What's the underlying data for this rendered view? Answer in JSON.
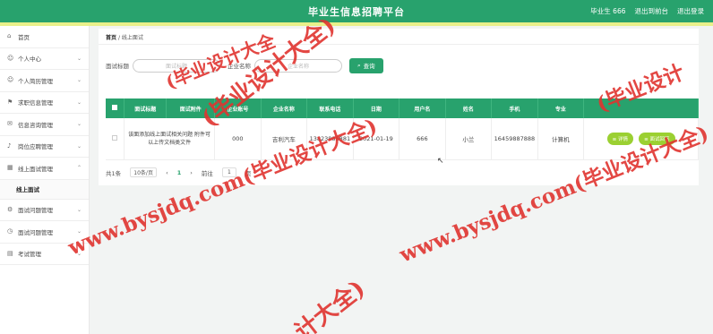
{
  "header": {
    "title": "毕业生信息招聘平台",
    "user": "毕业生 666",
    "backend_link": "退出到前台",
    "logout": "退出登录"
  },
  "sidebar": {
    "items": [
      {
        "label": "首页",
        "icon": "home-icon"
      },
      {
        "label": "个人中心",
        "icon": "user-icon"
      },
      {
        "label": "个人简历管理",
        "icon": "user-icon"
      },
      {
        "label": "求职信息管理",
        "icon": "flag-icon"
      },
      {
        "label": "信息咨询管理",
        "icon": "mail-icon"
      },
      {
        "label": "岗位应聘管理",
        "icon": "mic-icon"
      },
      {
        "label": "线上面试管理",
        "icon": "grid-icon",
        "expanded": true,
        "children": [
          "线上面试"
        ]
      },
      {
        "label": "面试问题管理",
        "icon": "gear-icon"
      },
      {
        "label": "面试问题管理",
        "icon": "clock-icon"
      },
      {
        "label": "考试管理",
        "icon": "doc-icon"
      }
    ]
  },
  "breadcrumb": {
    "home": "首页",
    "sep": "/",
    "current": "线上面试"
  },
  "search": {
    "label1": "面试标题",
    "placeholder1": "面试标题",
    "label2": "企业名称",
    "placeholder2": "企业名称",
    "button": "查询"
  },
  "table": {
    "headers": [
      "面试标题",
      "面试附件",
      "企业账号",
      "企业名称",
      "联系电话",
      "日期",
      "用户名",
      "姓名",
      "手机",
      "专业",
      ""
    ],
    "rows": [
      {
        "title": "该面添加线上面试相关问题 附件可以上传文档类文件",
        "attachment": "",
        "account": "000",
        "company": "吉利汽车",
        "phone": "13823888881",
        "date": "2021-01-19",
        "username": "666",
        "name": "小兰",
        "mobile": "16459887888",
        "major": "计算机",
        "btn_detail": "详情",
        "btn_answer": "面试回答"
      }
    ]
  },
  "pager": {
    "total": "共1条",
    "page_size": "10条/页",
    "prev": "‹",
    "page": "1",
    "next": "›",
    "goto": "前往",
    "goto_value": "1",
    "page_suffix": "页"
  },
  "watermark": {
    "text": "www.bysjdq.com(毕业设计大全)",
    "frag_a": "(毕业设计大全)",
    "frag_b": "计大全)",
    "frag_c": "(毕业设计",
    "frag_d": "(毕业设计大全"
  }
}
